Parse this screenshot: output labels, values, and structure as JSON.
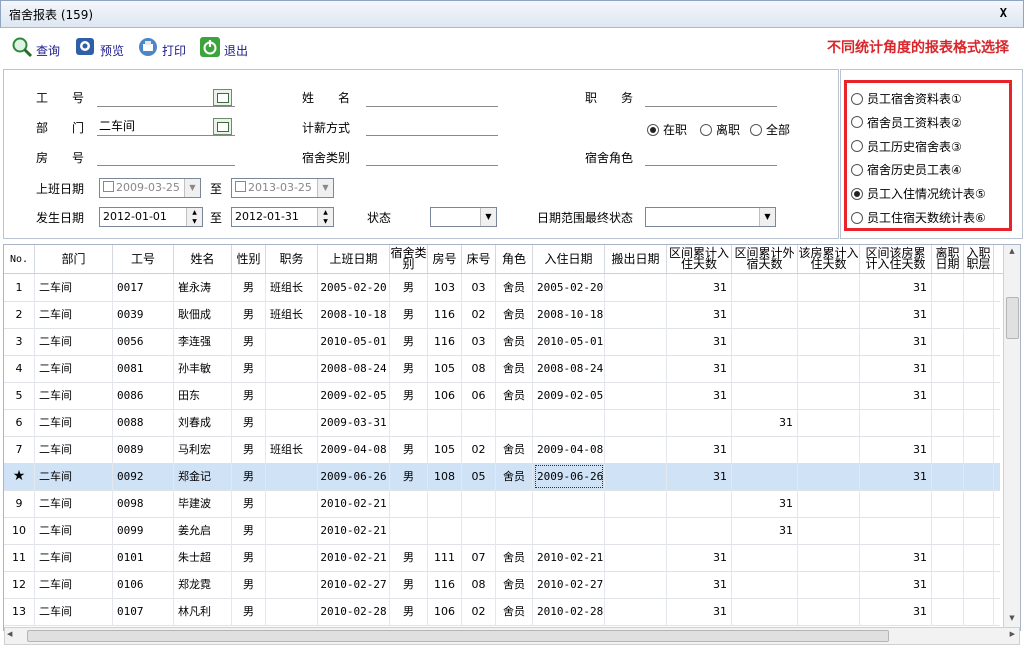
{
  "window": {
    "title": "宿舍报表 (159)",
    "close": "X"
  },
  "toolbar": {
    "query": "查询",
    "preview": "预览",
    "print": "打印",
    "exit": "退出",
    "hint": "不同统计角度的报表格式选择"
  },
  "filter": {
    "emp_no_label": "工　　号",
    "name_label": "姓　　名",
    "position_label": "职　　务",
    "dept_label": "部　　门",
    "dept_value": "二车间",
    "pay_label": "计薪方式",
    "room_label": "房　　号",
    "dorm_type_label": "宿舍类别",
    "dorm_role_label": "宿舍角色",
    "start_label": "上班日期",
    "start_from": "2009-03-25",
    "to1": "至",
    "start_to": "2013-03-25",
    "occur_label": "发生日期",
    "occur_from": "2012-01-01",
    "to2": "至",
    "occur_to": "2012-01-31",
    "status_label": "状态",
    "final_status_label": "日期范围最终状态",
    "emp_status": [
      {
        "label": "在职",
        "checked": true
      },
      {
        "label": "离职",
        "checked": false
      },
      {
        "label": "全部",
        "checked": false
      }
    ]
  },
  "reports": [
    {
      "label": "员工宿舍资料表①",
      "checked": false
    },
    {
      "label": "宿舍员工资料表②",
      "checked": false
    },
    {
      "label": "员工历史宿舍表③",
      "checked": false
    },
    {
      "label": "宿舍历史员工表④",
      "checked": false
    },
    {
      "label": "员工入住情况统计表⑤",
      "checked": true
    },
    {
      "label": "员工住宿天数统计表⑥",
      "checked": false
    }
  ],
  "grid": {
    "columns": [
      "No.",
      "部门",
      "工号",
      "姓名",
      "性别",
      "职务",
      "上班日期",
      "宿舍类别",
      "房号",
      "床号",
      "角色",
      "入住日期",
      "搬出日期",
      "区间累计入住天数",
      "区间累计外宿天数",
      "该房累计入住天数",
      "区间该房累计入住天数",
      "离职日期",
      "入职职层"
    ],
    "rows": [
      [
        "1",
        "二车间",
        "0017",
        "崔永涛",
        "男",
        "班组长",
        "2005-02-20",
        "男",
        "103",
        "03",
        "舍员",
        "2005-02-20",
        "",
        "31",
        "",
        "",
        "31",
        "",
        ""
      ],
      [
        "2",
        "二车间",
        "0039",
        "耿佃成",
        "男",
        "班组长",
        "2008-10-18",
        "男",
        "116",
        "02",
        "舍员",
        "2008-10-18",
        "",
        "31",
        "",
        "",
        "31",
        "",
        ""
      ],
      [
        "3",
        "二车间",
        "0056",
        "李连强",
        "男",
        "",
        "2010-05-01",
        "男",
        "116",
        "03",
        "舍员",
        "2010-05-01",
        "",
        "31",
        "",
        "",
        "31",
        "",
        ""
      ],
      [
        "4",
        "二车间",
        "0081",
        "孙丰敏",
        "男",
        "",
        "2008-08-24",
        "男",
        "105",
        "08",
        "舍员",
        "2008-08-24",
        "",
        "31",
        "",
        "",
        "31",
        "",
        ""
      ],
      [
        "5",
        "二车间",
        "0086",
        "田东",
        "男",
        "",
        "2009-02-05",
        "男",
        "106",
        "06",
        "舍员",
        "2009-02-05",
        "",
        "31",
        "",
        "",
        "31",
        "",
        ""
      ],
      [
        "6",
        "二车间",
        "0088",
        "刘春成",
        "男",
        "",
        "2009-03-31",
        "",
        "",
        "",
        "",
        "",
        "",
        "",
        "31",
        "",
        "",
        "",
        ""
      ],
      [
        "7",
        "二车间",
        "0089",
        "马利宏",
        "男",
        "班组长",
        "2009-04-08",
        "男",
        "105",
        "02",
        "舍员",
        "2009-04-08",
        "",
        "31",
        "",
        "",
        "31",
        "",
        ""
      ],
      [
        "★",
        "二车间",
        "0092",
        "郑金记",
        "男",
        "",
        "2009-06-26",
        "男",
        "108",
        "05",
        "舍员",
        "2009-06-26",
        "",
        "31",
        "",
        "",
        "31",
        "",
        ""
      ],
      [
        "9",
        "二车间",
        "0098",
        "毕建波",
        "男",
        "",
        "2010-02-21",
        "",
        "",
        "",
        "",
        "",
        "",
        "",
        "31",
        "",
        "",
        "",
        ""
      ],
      [
        "10",
        "二车间",
        "0099",
        "姜允启",
        "男",
        "",
        "2010-02-21",
        "",
        "",
        "",
        "",
        "",
        "",
        "",
        "31",
        "",
        "",
        "",
        ""
      ],
      [
        "11",
        "二车间",
        "0101",
        "朱士超",
        "男",
        "",
        "2010-02-21",
        "男",
        "111",
        "07",
        "舍员",
        "2010-02-21",
        "",
        "31",
        "",
        "",
        "31",
        "",
        ""
      ],
      [
        "12",
        "二车间",
        "0106",
        "郑龙霓",
        "男",
        "",
        "2010-02-27",
        "男",
        "116",
        "08",
        "舍员",
        "2010-02-27",
        "",
        "31",
        "",
        "",
        "31",
        "",
        ""
      ],
      [
        "13",
        "二车间",
        "0107",
        "林凡利",
        "男",
        "",
        "2010-02-28",
        "男",
        "106",
        "02",
        "舍员",
        "2010-02-28",
        "",
        "31",
        "",
        "",
        "31",
        "",
        ""
      ]
    ],
    "selected_row": 7
  },
  "icons": {
    "query": "magnifier-icon",
    "preview": "preview-icon",
    "print": "printer-icon",
    "exit": "power-icon"
  }
}
